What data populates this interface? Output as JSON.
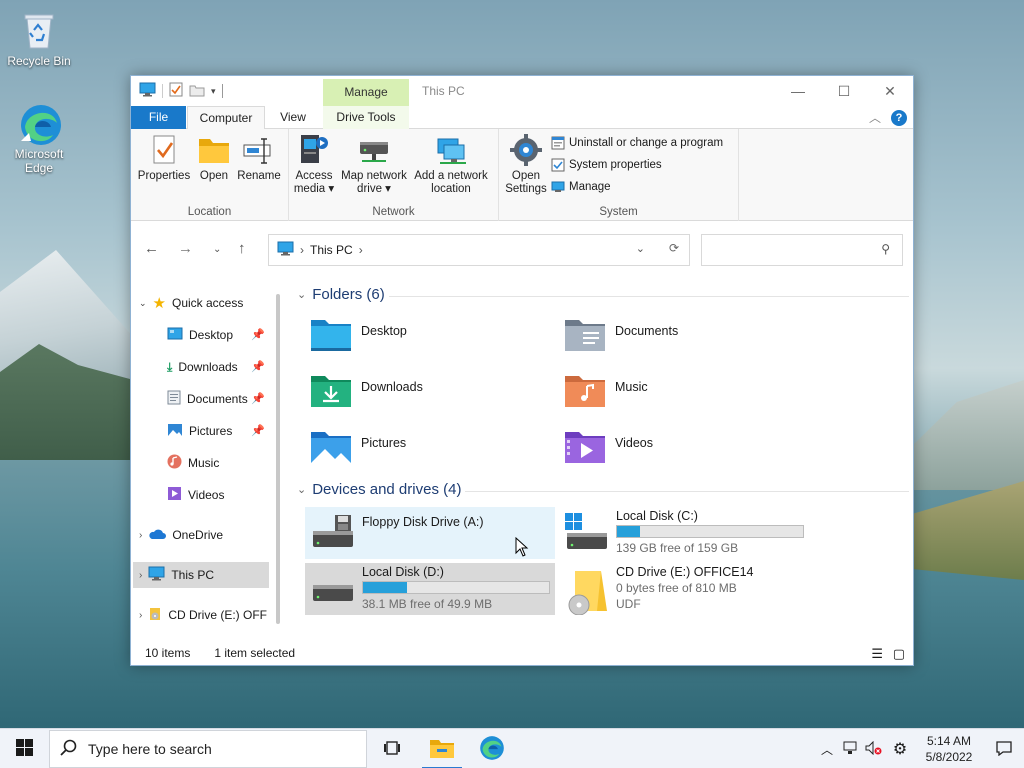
{
  "desktop": {
    "icons": [
      {
        "label": "Recycle Bin"
      },
      {
        "label": "Microsoft Edge"
      }
    ]
  },
  "window": {
    "title": "This PC",
    "contextual_tab_header": "Manage",
    "tabs": {
      "file": "File",
      "computer": "Computer",
      "view": "View",
      "drive_tools": "Drive Tools"
    },
    "ribbon": {
      "location": {
        "label": "Location",
        "properties": "Properties",
        "open": "Open",
        "rename": "Rename"
      },
      "network": {
        "label": "Network",
        "access_media_1": "Access",
        "access_media_2": "media",
        "map_drive_1": "Map network",
        "map_drive_2": "drive",
        "add_location_1": "Add a network",
        "add_location_2": "location"
      },
      "system": {
        "label": "System",
        "open_settings_1": "Open",
        "open_settings_2": "Settings",
        "uninstall": "Uninstall or change a program",
        "system_properties": "System properties",
        "manage": "Manage"
      }
    },
    "address": {
      "path": "This PC",
      "search_placeholder": ""
    },
    "sidebar": {
      "quick_access": "Quick access",
      "items": [
        {
          "label": "Desktop"
        },
        {
          "label": "Downloads"
        },
        {
          "label": "Documents"
        },
        {
          "label": "Pictures"
        },
        {
          "label": "Music"
        },
        {
          "label": "Videos"
        }
      ],
      "onedrive": "OneDrive",
      "this_pc": "This PC",
      "cd_drive": "CD Drive (E:) OFF"
    },
    "folders": {
      "header": "Folders (6)",
      "items": [
        "Desktop",
        "Documents",
        "Downloads",
        "Music",
        "Pictures",
        "Videos"
      ]
    },
    "devices": {
      "header": "Devices and drives (4)",
      "floppy": {
        "name": "Floppy Disk Drive (A:)"
      },
      "c": {
        "name": "Local Disk (C:)",
        "free": "139 GB free of 159 GB",
        "used_fraction": 0.126
      },
      "d": {
        "name": "Local Disk (D:)",
        "free": "38.1 MB free of 49.9 MB",
        "used_fraction": 0.236
      },
      "e": {
        "name": "CD Drive (E:) OFFICE14",
        "line2": "0 bytes free of 810 MB",
        "line3": "UDF"
      }
    },
    "status": {
      "count": "10 items",
      "selected": "1 item selected"
    }
  },
  "taskbar": {
    "search_placeholder": "Type here to search",
    "time": "5:14 AM",
    "date": "5/8/2022"
  },
  "colors": {
    "accent": "#1979ca",
    "manage_tab": "#d8f0b4",
    "drive_bar": "#26a0da"
  }
}
